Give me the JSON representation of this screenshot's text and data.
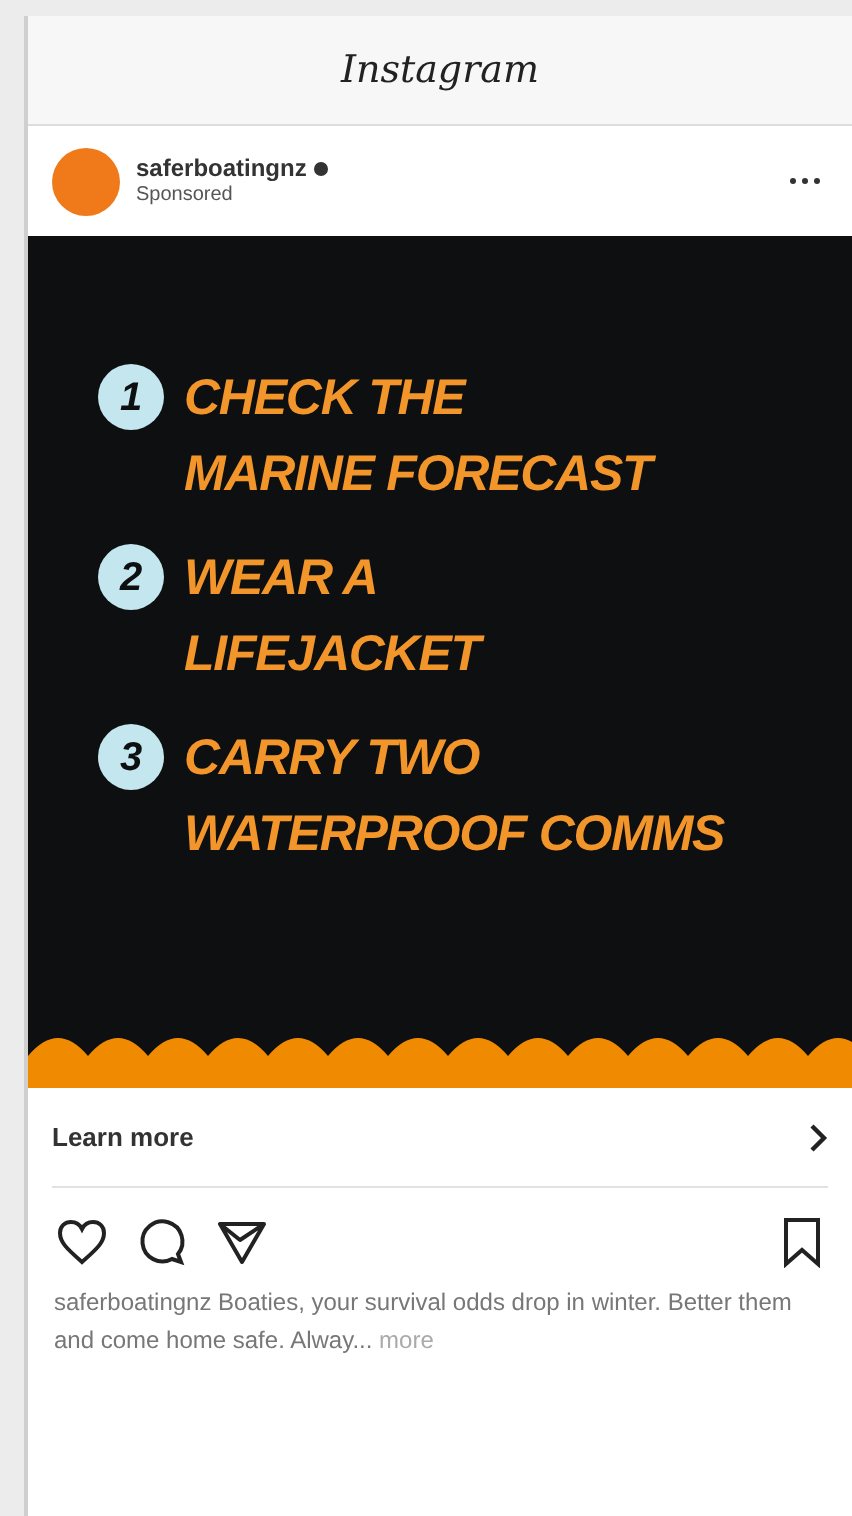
{
  "app_header": {
    "title": "Instagram"
  },
  "post": {
    "username": "saferboatingnz",
    "verified": true,
    "subtitle": "Sponsored",
    "ad_steps": [
      {
        "number": "1",
        "text": "CHECK THE\nMARINE FORECAST"
      },
      {
        "number": "2",
        "text": "WEAR A\nLIFEJACKET"
      },
      {
        "number": "3",
        "text": "CARRY TWO\nWATERPROOF COMMS"
      }
    ],
    "cta": "Learn more",
    "caption": "saferboatingnz Boaties, your survival odds drop in winter. Better them and come home safe. Alway...",
    "more_link": "more"
  }
}
